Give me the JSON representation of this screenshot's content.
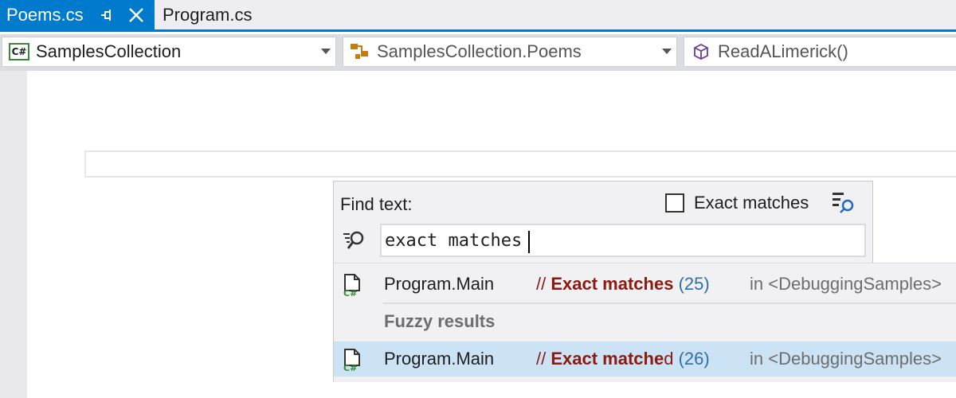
{
  "tabs": [
    {
      "label": "Poems.cs",
      "active": true
    },
    {
      "label": "Program.cs",
      "active": false
    }
  ],
  "navbar": {
    "project": "SamplesCollection",
    "project_icon": "C#",
    "type": "SamplesCollection.Poems",
    "member": "ReadALimerick()"
  },
  "find": {
    "label": "Find text:",
    "exact_matches_label": "Exact matches",
    "exact_matches_checked": false,
    "query": "exact matches"
  },
  "results": {
    "exact": [
      {
        "name": "Program.Main",
        "comment_prefix": "// ",
        "match_bold": "Exact matches",
        "match_tail": "",
        "count": "(25)",
        "location": "in <DebuggingSamples>"
      }
    ],
    "fuzzy_header": "Fuzzy results",
    "fuzzy": [
      {
        "name": "Program.Main",
        "comment_prefix": "// ",
        "match_bold": "Exact matche",
        "match_tail": "d",
        "count": "(26)",
        "location": "in <DebuggingSamples>"
      }
    ]
  },
  "colors": {
    "accent": "#007acc",
    "selection": "#cce3f5",
    "comment_match": "#8b1a10",
    "count": "#2f6fab"
  }
}
